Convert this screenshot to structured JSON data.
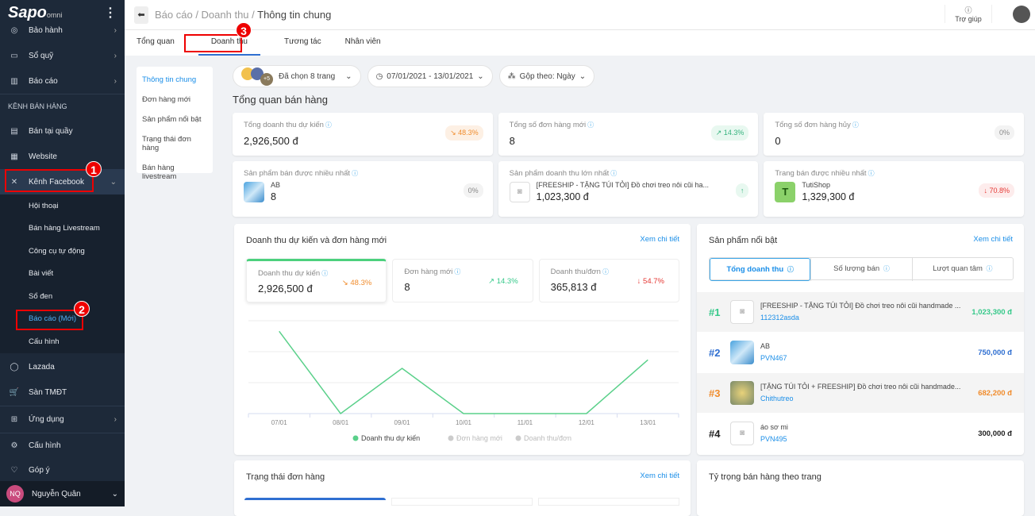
{
  "brand": {
    "name": "Sapo",
    "suffix": "omni"
  },
  "sidebar": {
    "items": [
      {
        "label": "Bảo hành",
        "icon": "shield-icon"
      },
      {
        "label": "Sổ quỹ",
        "icon": "cash-icon"
      },
      {
        "label": "Báo cáo",
        "icon": "chart-icon"
      }
    ],
    "section": "KÊNH BÁN HÀNG",
    "channels": [
      {
        "label": "Bán tại quầy",
        "icon": "pos-icon"
      },
      {
        "label": "Website",
        "icon": "store-icon"
      },
      {
        "label": "Kênh Facebook",
        "icon": "network-icon"
      }
    ],
    "fb_sub": [
      "Hội thoại",
      "Bán hàng Livestream",
      "Công cụ tự động",
      "Bài viết",
      "Sổ đen",
      "Báo cáo (Mới)",
      "Cấu hình"
    ],
    "more": [
      {
        "label": "Lazada",
        "icon": "lazada-icon"
      },
      {
        "label": "Sàn TMĐT",
        "icon": "cart-icon"
      }
    ],
    "bottom": [
      {
        "label": "Ứng dụng",
        "icon": "apps-icon"
      },
      {
        "label": "Cấu hình",
        "icon": "gear-icon"
      },
      {
        "label": "Góp ý",
        "icon": "feedback-icon"
      }
    ],
    "user": {
      "initials": "NQ",
      "name": "Nguyễn Quân"
    }
  },
  "annotations": [
    "1",
    "2",
    "3"
  ],
  "header": {
    "crumb1": "Báo cáo / Doanh thu / ",
    "current": "Thông tin chung",
    "help": "Trợ giúp"
  },
  "tabs": [
    "Tổng quan",
    "Doanh thu",
    "Tương tác",
    "Nhân viên"
  ],
  "leftnav": [
    "Thông tin chung",
    "Đơn hàng mới",
    "Sản phẩm nổi bật",
    "Trạng thái đơn hàng",
    "Bán hàng livestream"
  ],
  "filters": {
    "pages": "Đã chọn 8 trang",
    "pages_more": "+5",
    "date": "07/01/2021 - 13/01/2021",
    "group": "Gộp theo: Ngày"
  },
  "overview": {
    "title": "Tổng quan bán hàng",
    "cards": [
      {
        "label": "Tổng doanh thu dự kiến",
        "value": "2,926,500 đ",
        "delta": "↘ 48.3%",
        "tone": "orange"
      },
      {
        "label": "Tổng số đơn hàng mới",
        "value": "8",
        "delta": "↗ 14.3%",
        "tone": "green"
      },
      {
        "label": "Tổng số đơn hàng hủy",
        "value": "0",
        "delta": "0%",
        "tone": "grey"
      }
    ],
    "products": [
      {
        "label": "Sản phẩm bán được nhiều nhất",
        "name": "AB",
        "value": "8",
        "delta": "0%",
        "tone": "grey"
      },
      {
        "label": "Sản phẩm doanh thu lớn nhất",
        "name": "[FREESHIP - TẶNG TÚI TỎI] Đồ chơi treo nôi cũi ha...",
        "value": "1,023,300 đ",
        "delta": "↑",
        "tone": "green"
      },
      {
        "label": "Trang bán được nhiều nhất",
        "name": "TutiShop",
        "avatar": "T",
        "value": "1,329,300 đ",
        "delta": "↓ 70.8%",
        "tone": "red"
      }
    ]
  },
  "revenue": {
    "title": "Doanh thu dự kiến và đơn hàng mới",
    "link": "Xem chi tiết",
    "kpis": [
      {
        "label": "Doanh thu dự kiến",
        "value": "2,926,500 đ",
        "delta": "↘ 48.3%",
        "color": "#f08c2d"
      },
      {
        "label": "Đơn hàng mới",
        "value": "8",
        "delta": "↗ 14.3%",
        "color": "#36c98a"
      },
      {
        "label": "Doanh thu/đơn",
        "value": "365,813 đ",
        "delta": "↓ 54.7%",
        "color": "#e53935"
      }
    ]
  },
  "chart_data": {
    "type": "line",
    "x": [
      "07/01",
      "08/01",
      "09/01",
      "10/01",
      "11/01",
      "12/01",
      "13/01"
    ],
    "series": [
      {
        "name": "Doanh thu dự kiến",
        "values": [
          1329300,
          0,
          730000,
          0,
          0,
          0,
          867200
        ],
        "color": "#5ad08a",
        "active": true
      },
      {
        "name": "Đơn hàng mới",
        "active": false
      },
      {
        "name": "Doanh thu/đơn",
        "active": false
      }
    ],
    "ylim": [
      0,
      1500000
    ],
    "grid": true,
    "legend": "bottom"
  },
  "featured": {
    "title": "Sản phẩm nổi bật",
    "link": "Xem chi tiết",
    "tabs": [
      "Tổng doanh thu",
      "Số lượng bán",
      "Lượt quan tâm"
    ],
    "items": [
      {
        "rank": "#1",
        "name": "[FREESHIP - TẶNG TÚI TỎI] Đồ chơi treo nôi cũi handmade ...",
        "sku": "112312asda",
        "amount": "1,023,300 đ",
        "color": "#36c98a",
        "thumb": "ph"
      },
      {
        "rank": "#2",
        "name": "AB",
        "sku": "PVN467",
        "amount": "750,000 đ",
        "color": "#2f6fd1",
        "thumb": "sky"
      },
      {
        "rank": "#3",
        "name": "[TẶNG TÚI TỎI + FREESHIP] Đồ chơi treo nôi cũi handmade...",
        "sku": "Chithutreo",
        "amount": "682,200 đ",
        "color": "#f08c2d",
        "thumb": "toy"
      },
      {
        "rank": "#4",
        "name": "áo sơ mi",
        "sku": "PVN495",
        "amount": "300,000 đ",
        "color": "#222",
        "thumb": "ph"
      }
    ]
  },
  "status": {
    "title": "Trạng thái đơn hàng",
    "link": "Xem chi tiết"
  },
  "share": {
    "title": "Tỷ trọng bán hàng theo trang"
  }
}
